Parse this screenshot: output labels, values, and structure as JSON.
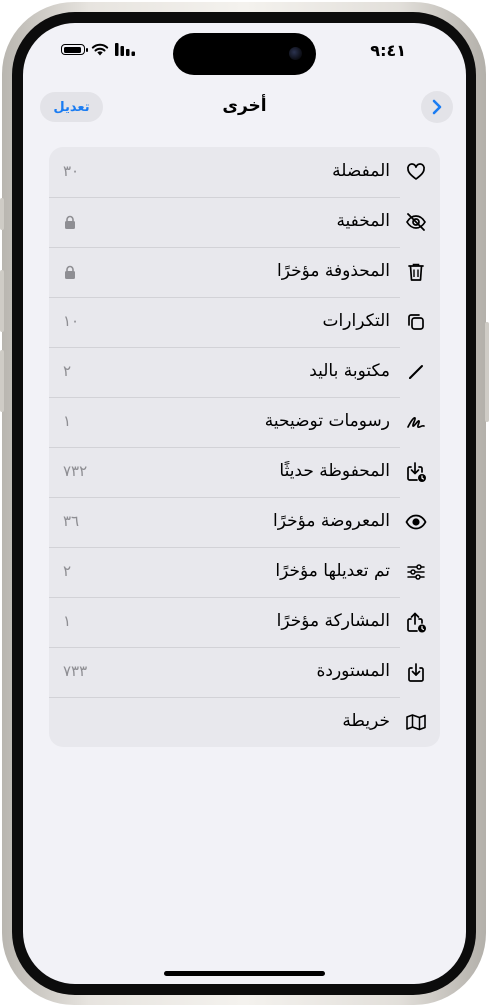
{
  "status_bar": {
    "time": "٩:٤١"
  },
  "navbar": {
    "title": "أخرى",
    "edit_label": "تعديل"
  },
  "rows": [
    {
      "label": "المفضلة",
      "value": "٣٠",
      "icon": "heart-icon"
    },
    {
      "label": "المخفية",
      "value": "",
      "icon": "eye-slash-icon",
      "locked": true
    },
    {
      "label": "المحذوفة مؤخرًا",
      "value": "",
      "icon": "trash-icon",
      "locked": true
    },
    {
      "label": "التكرارات",
      "value": "١٠",
      "icon": "duplicate-icon"
    },
    {
      "label": "مكتوبة باليد",
      "value": "٢",
      "icon": "pencil-icon"
    },
    {
      "label": "رسومات توضيحية",
      "value": "١",
      "icon": "scribble-icon"
    },
    {
      "label": "المحفوظة حديثًا",
      "value": "٧٣٢",
      "icon": "tray-download-icon"
    },
    {
      "label": "المعروضة مؤخرًا",
      "value": "٣٦",
      "icon": "eye-icon"
    },
    {
      "label": "تم تعديلها مؤخرًا",
      "value": "٢",
      "icon": "sliders-icon"
    },
    {
      "label": "المشاركة مؤخرًا",
      "value": "١",
      "icon": "share-icon"
    },
    {
      "label": "المستوردة",
      "value": "٧٣٣",
      "icon": "import-icon"
    },
    {
      "label": "خريطة",
      "value": "",
      "icon": "map-icon"
    }
  ],
  "colors": {
    "accent": "#1a7cf2",
    "background": "#f2f2f7",
    "list_background": "#e8e8ed",
    "secondary_text": "#8e8e93"
  }
}
